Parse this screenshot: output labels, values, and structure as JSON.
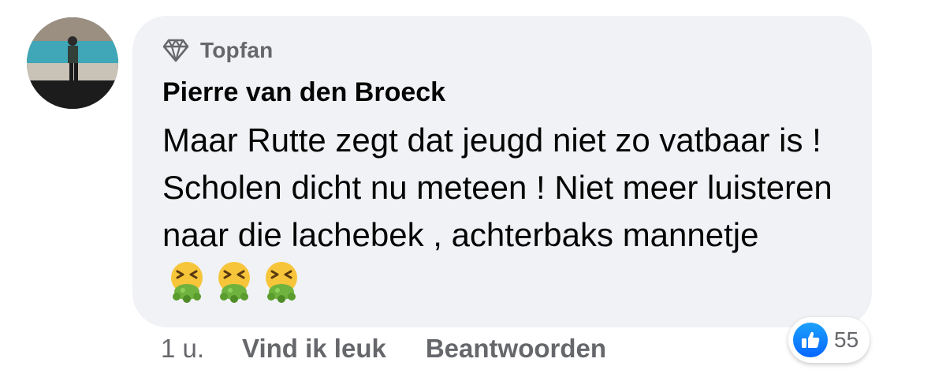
{
  "comment": {
    "badge": {
      "label": "Topfan",
      "icon": "diamond-icon"
    },
    "author": "Pierre van den Broeck",
    "text": "Maar Rutte zegt dat jeugd niet zo vatbaar is ! Scholen dicht nu meteen ! Niet meer luisteren naar die lachebek , achterbaks mannetje",
    "emojis": [
      "vomiting-face-emoji",
      "vomiting-face-emoji",
      "vomiting-face-emoji"
    ],
    "timestamp": "1 u.",
    "actions": {
      "like_label": "Vind ik leuk",
      "reply_label": "Beantwoorden"
    },
    "reactions": {
      "icon": "thumbs-up-icon",
      "count": "55"
    }
  },
  "colors": {
    "bubble": "#f0f2f5",
    "text": "#050505",
    "secondary": "#65676b",
    "like_blue": "#0866ff"
  }
}
